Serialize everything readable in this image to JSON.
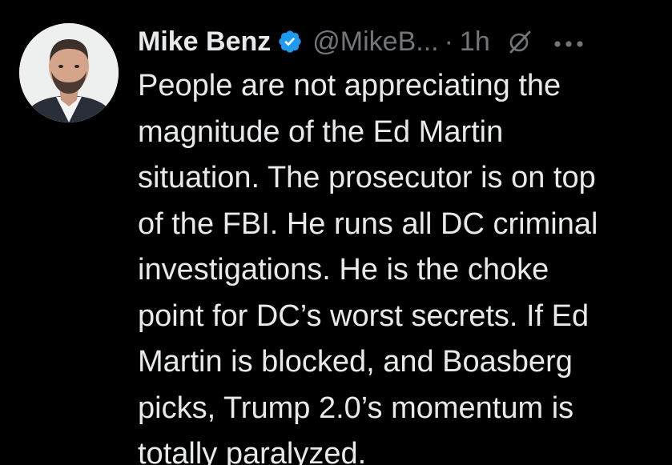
{
  "author": {
    "name": "Mike Benz",
    "handle": "@MikeB...",
    "separator": "·",
    "time": "1h",
    "verified": true
  },
  "icons": {
    "verified": "verified-badge-icon",
    "grok": "grok-icon",
    "more": "more-options-icon"
  },
  "colors": {
    "background": "#000000",
    "text": "#e7e9ea",
    "secondary": "#71767b",
    "verified": "#1d9bf0"
  },
  "tweet": {
    "lines": [
      "People are not appreciating the",
      "magnitude of the Ed Martin",
      "situation. The prosecutor is on top",
      "of the FBI. He runs all DC criminal",
      "investigations. He is the choke",
      "point for DC’s worst secrets. If Ed",
      "Martin is blocked, and Boasberg",
      "picks, Trump 2.0’s momentum is",
      "totally paralyzed."
    ]
  }
}
